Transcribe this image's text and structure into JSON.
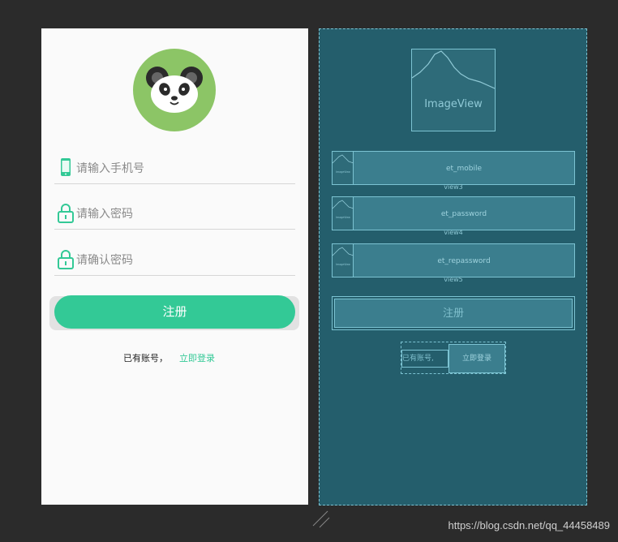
{
  "design": {
    "avatar": "panda-avatar",
    "mobile": {
      "icon": "phone-icon",
      "placeholder": "请输入手机号"
    },
    "password": {
      "icon": "lock-icon",
      "placeholder": "请输入密码"
    },
    "confirm": {
      "icon": "lock-icon",
      "placeholder": "请确认密码"
    },
    "register_label": "注册",
    "has_account": "已有账号，",
    "login_link": "立即登录"
  },
  "blueprint": {
    "image_label": "ImageView",
    "mini_label": "ImageView",
    "rows": [
      {
        "id": "et_mobile",
        "sub": "view3"
      },
      {
        "id": "et_password",
        "sub": "view4"
      },
      {
        "id": "et_repassword",
        "sub": "view5"
      }
    ],
    "register_label": "注册",
    "has_account": "已有账号,",
    "login_link": "立即登录"
  },
  "watermark": "https://blog.csdn.net/qq_44458489",
  "colors": {
    "accent": "#33c996",
    "avatar_bg": "#8cc566",
    "blueprint_bg": "#245e6c",
    "canvas": "#2b2b2b"
  }
}
